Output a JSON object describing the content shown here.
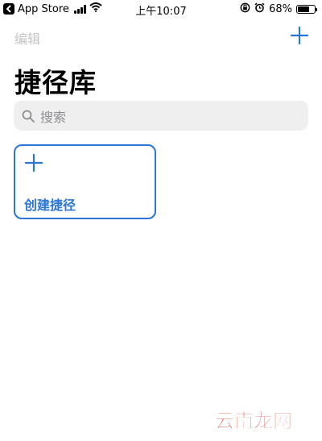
{
  "status_bar": {
    "back_app": "App Store",
    "time": "上午10:07",
    "battery_percent": "68%",
    "battery_level": 0.68,
    "icons": [
      "back-arrow-icon",
      "cellular-signal-icon",
      "wifi-icon",
      "orientation-lock-icon",
      "alarm-icon",
      "battery-icon"
    ]
  },
  "nav": {
    "edit_label": "编辑",
    "add_icon": "plus-icon"
  },
  "page": {
    "title": "捷径库"
  },
  "search": {
    "placeholder": "搜索",
    "icon": "search-icon"
  },
  "create_card": {
    "label": "创建捷径",
    "icon": "plus-icon"
  },
  "watermark": {
    "text": "云南龙网"
  },
  "colors": {
    "accent": "#2a75d6",
    "disabled_text": "#c4c4c6",
    "search_bg": "#efeff0",
    "placeholder": "#8e8e93",
    "watermark_red": "#c8241a"
  }
}
